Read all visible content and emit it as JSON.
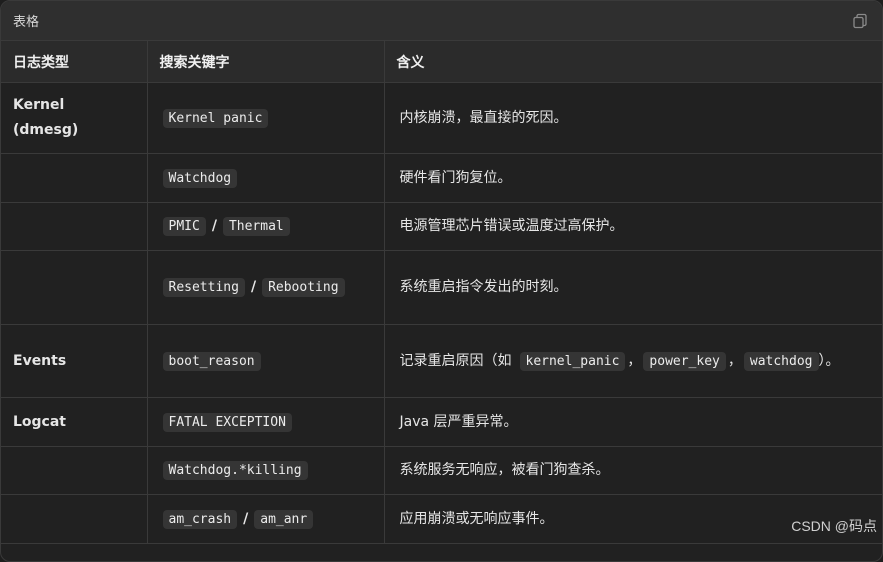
{
  "window": {
    "title": "表格",
    "copy_icon": "copy-icon"
  },
  "table": {
    "headers": [
      "日志类型",
      "搜索关键字",
      "含义"
    ],
    "rows": [
      {
        "type": "Kernel (dmesg)",
        "keywords": [
          "Kernel panic"
        ],
        "meaning": "内核崩溃，最直接的死因。"
      },
      {
        "type": "",
        "keywords": [
          "Watchdog"
        ],
        "meaning": "硬件看门狗复位。"
      },
      {
        "type": "",
        "keywords": [
          "PMIC",
          "Thermal"
        ],
        "meaning": "电源管理芯片错误或温度过高保护。"
      },
      {
        "type": "",
        "keywords": [
          "Resetting",
          "Rebooting"
        ],
        "meaning": "系统重启指令发出的时刻。"
      },
      {
        "type": "Events",
        "keywords": [
          "boot_reason"
        ],
        "meaning_prefix": "记录重启原因（如",
        "meaning_codes": [
          "kernel_panic",
          "power_key",
          "watchdog"
        ],
        "meaning_suffix": "）。"
      },
      {
        "type": "Logcat",
        "keywords": [
          "FATAL EXCEPTION"
        ],
        "meaning": "Java 层严重异常。"
      },
      {
        "type": "",
        "keywords": [
          "Watchdog.*killing"
        ],
        "meaning": "系统服务无响应，被看门狗查杀。"
      },
      {
        "type": "",
        "keywords": [
          "am_crash",
          "am_anr"
        ],
        "meaning": "应用崩溃或无响应事件。"
      }
    ],
    "keyword_separator": "/",
    "list_separator": "，"
  },
  "watermark": "CSDN @码点"
}
